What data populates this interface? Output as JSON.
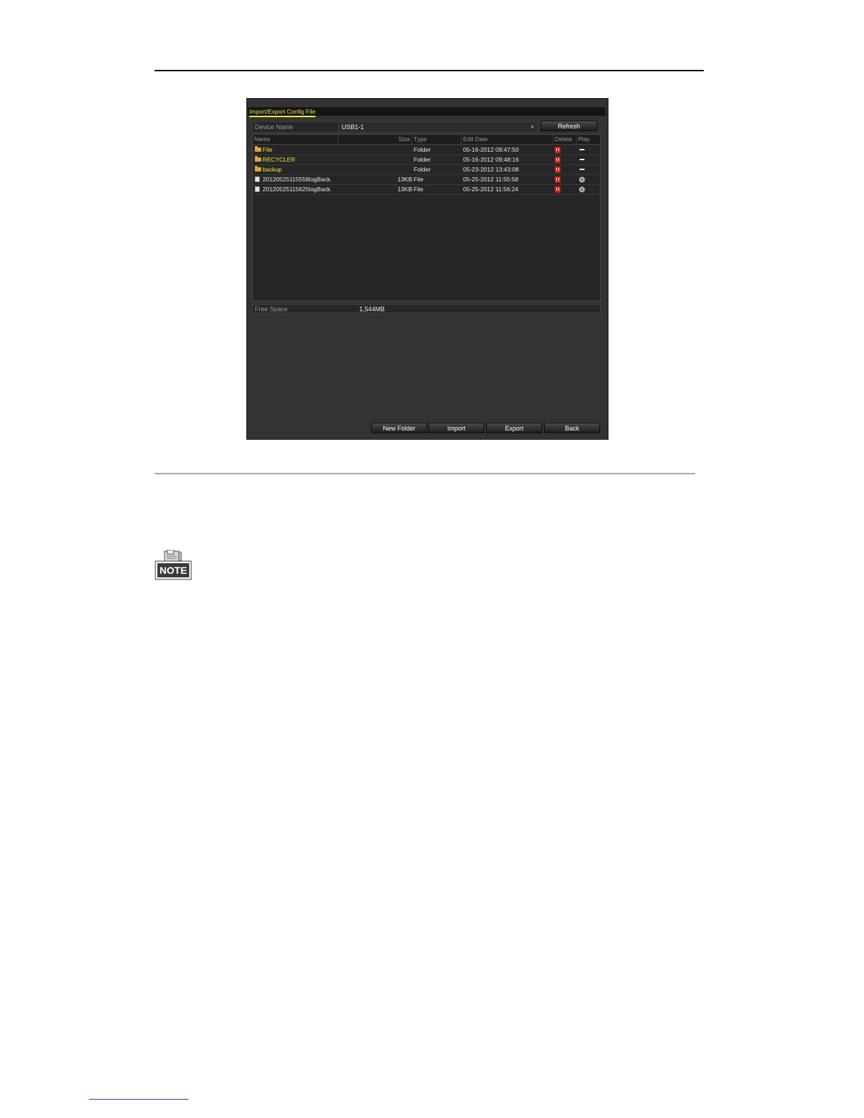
{
  "window": {
    "title": "Import/Export Config File"
  },
  "device": {
    "label": "Device Name",
    "value": "USB1-1",
    "dropdown_arrow": "▾",
    "refresh_label": "Refresh"
  },
  "table": {
    "headers": {
      "name": "Name",
      "size": "Size",
      "type": "Type",
      "edit_date": "Edit Date",
      "delete": "Delete",
      "play": "Play"
    },
    "rows": [
      {
        "icon": "folder-icon",
        "name": "File",
        "size": "",
        "type": "Folder",
        "edit_date": "05-16-2012 09:47:50",
        "play": "dash"
      },
      {
        "icon": "folder-icon",
        "name": "RECYCLER",
        "size": "",
        "type": "Folder",
        "edit_date": "05-16-2012 09:48:16",
        "play": "dash"
      },
      {
        "icon": "folder-icon",
        "name": "backup",
        "size": "",
        "type": "Folder",
        "edit_date": "05-23-2012 13:43:08",
        "play": "dash"
      },
      {
        "icon": "file-icon",
        "name": "20120525115558logBack.",
        "size": "13KB",
        "type": "File",
        "edit_date": "05-25-2012 11:55:58",
        "play": "play-icon"
      },
      {
        "icon": "file-icon",
        "name": "20120525115625logBack.",
        "size": "13KB",
        "type": "File",
        "edit_date": "05-25-2012 11:56:24",
        "play": "play-icon"
      }
    ]
  },
  "free_space": {
    "label": "Free Space",
    "value": "1,544MB"
  },
  "buttons": {
    "new_folder": "New Folder",
    "import": "Import",
    "export": "Export",
    "back": "Back"
  },
  "note": {
    "label": "NOTE"
  },
  "colors": {
    "folder_text": "#f2e24a",
    "window_bg": "#333333",
    "delete_icon": "#d2231b"
  }
}
